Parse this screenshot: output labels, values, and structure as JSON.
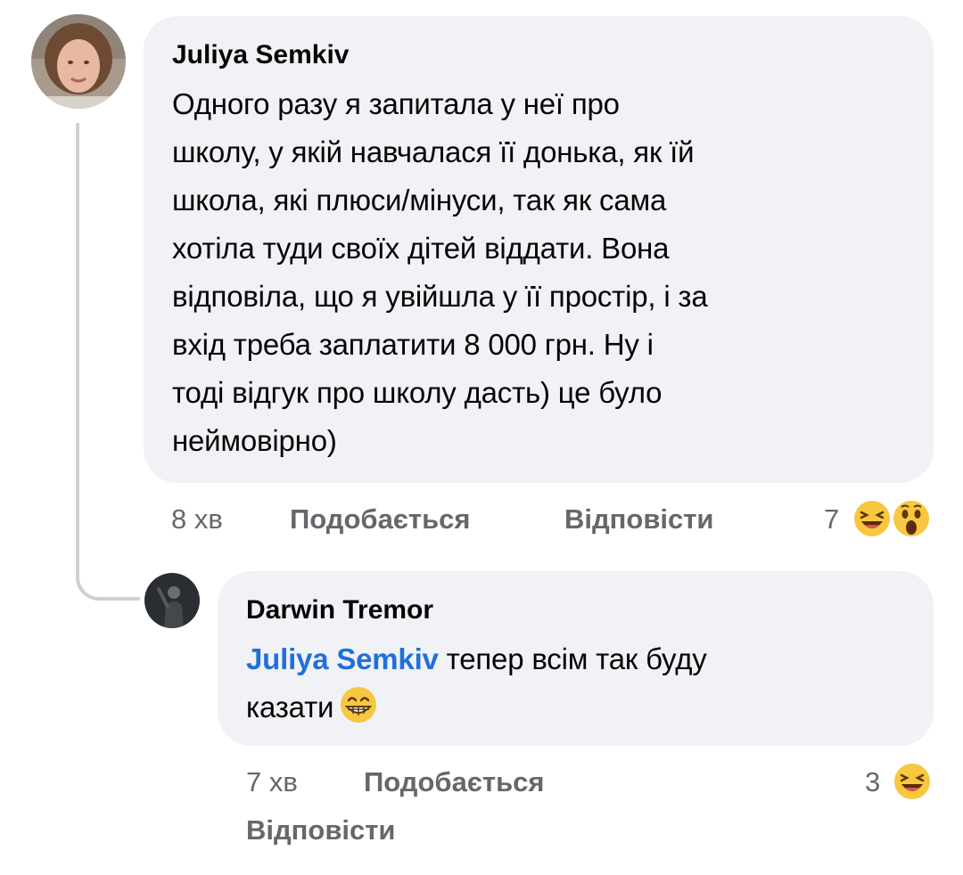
{
  "comments": [
    {
      "author": "Juliya Semkiv",
      "text": "Одного разу я запитала у неї про школу, у якій навчалася її донька, як їй школа, які плюси/мінуси, так як сама хотіла туди своїх дітей віддати. Вона відповіла, що я увійшла у її простір, і за вхід треба заплатити 8 000 грн. Ну і тоді відгук про школу дасть) це було неймовірно)",
      "lines": [
        "Одного разу я запитала у неї про",
        "школу, у якій навчалася її донька, як їй",
        "школа, які плюси/мінуси, так як сама",
        "хотіла туди своїх дітей віддати. Вона",
        "відповіла, що я увійшла у її простір, і за",
        "вхід треба заплатити 8 000 грн. Ну і",
        "тоді відгук про школу дасть) це було",
        "неймовірно)"
      ],
      "time": "8 хв",
      "like_label": "Подобається",
      "reply_label": "Відповісти",
      "reaction_count": "7",
      "reactions": [
        "laughing-emoji",
        "wow-emoji"
      ]
    },
    {
      "author": "Darwin Tremor",
      "mention": "Juliya Semkiv",
      "text_after_mention": "тепер всім так буду",
      "text_line2": "казати",
      "inline_emoji": "grinning-emoji",
      "time": "7 хв",
      "like_label": "Подобається",
      "reply_label": "Відповісти",
      "reaction_count": "3",
      "reactions": [
        "laughing-emoji"
      ]
    }
  ],
  "colors": {
    "bubble": "#f0f2f5",
    "meta_text": "#65676b",
    "mention": "#216fdb",
    "thread_line": "#ced0d4"
  }
}
